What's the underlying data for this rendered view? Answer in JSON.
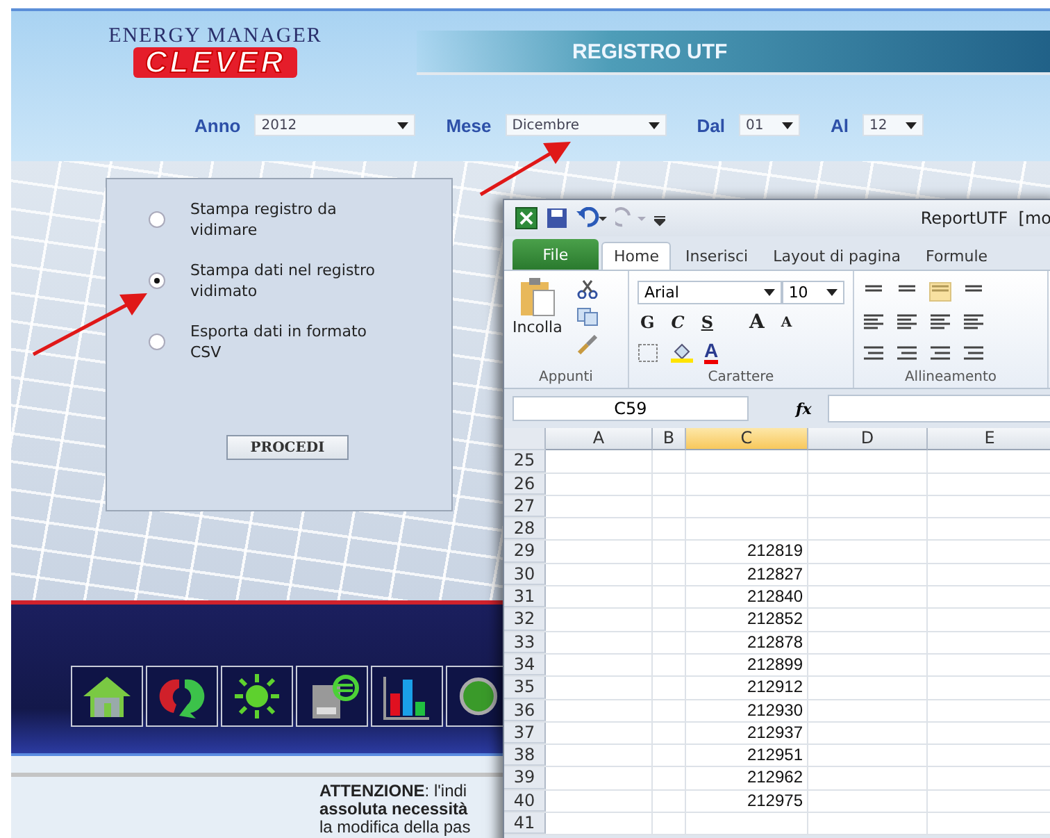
{
  "app": {
    "logo": {
      "line1": "ENERGY MANAGER",
      "line2": "CLEVER"
    },
    "banner_title": "REGISTRO UTF",
    "filters": [
      {
        "label": "Anno",
        "value": "2012",
        "kind": "wide"
      },
      {
        "label": "Mese",
        "value": "Dicembre",
        "kind": "wide"
      },
      {
        "label": "Dal",
        "value": "01",
        "kind": "narrow"
      },
      {
        "label": "Al",
        "value": "12",
        "kind": "narrow"
      }
    ],
    "options": [
      {
        "label": "Stampa registro da vidimare",
        "selected": false
      },
      {
        "label": "Stampa dati nel registro vidimato",
        "selected": true
      },
      {
        "label": "Esporta dati in formato CSV",
        "selected": false
      }
    ],
    "proceed_button": "PROCEDI",
    "notice_lines": [
      "**ATTENZIONE**: l'indi",
      "**assoluta necessità**",
      "la modifica della pas"
    ]
  },
  "excel": {
    "title": "ReportUTF  [mo",
    "tabs": [
      {
        "label": "File",
        "kind": "file",
        "selected": false
      },
      {
        "label": "Home",
        "kind": "tab",
        "selected": true
      },
      {
        "label": "Inserisci",
        "kind": "tab",
        "selected": false
      },
      {
        "label": "Layout di pagina",
        "kind": "tab",
        "selected": false
      },
      {
        "label": "Formule",
        "kind": "tab",
        "selected": false
      }
    ],
    "paste_label": "Incolla",
    "font_name": "Arial",
    "font_size": "10",
    "style_buttons": [
      "G",
      "C",
      "S"
    ],
    "grow_font": "A",
    "shrink_font": "A",
    "font_color": "A",
    "groups": [
      "Appunti",
      "Carattere",
      "Allineamento"
    ],
    "name_box": "C59",
    "fx": "fx",
    "columns": [
      {
        "label": "A",
        "selected": false
      },
      {
        "label": "B",
        "selected": false
      },
      {
        "label": "C",
        "selected": true
      },
      {
        "label": "D",
        "selected": false
      },
      {
        "label": "E",
        "selected": false
      }
    ],
    "rows": [
      {
        "number": "25"
      },
      {
        "number": "26"
      },
      {
        "number": "27"
      },
      {
        "number": "28"
      },
      {
        "number": "29",
        "c": "212819"
      },
      {
        "number": "30",
        "c": "212827"
      },
      {
        "number": "31",
        "c": "212840"
      },
      {
        "number": "32",
        "c": "212852"
      },
      {
        "number": "33",
        "c": "212878"
      },
      {
        "number": "34",
        "c": "212899"
      },
      {
        "number": "35",
        "c": "212912"
      },
      {
        "number": "36",
        "c": "212930"
      },
      {
        "number": "37",
        "c": "212937"
      },
      {
        "number": "38",
        "c": "212951"
      },
      {
        "number": "39",
        "c": "212962"
      },
      {
        "number": "40",
        "c": "212975"
      },
      {
        "number": "41"
      }
    ]
  }
}
